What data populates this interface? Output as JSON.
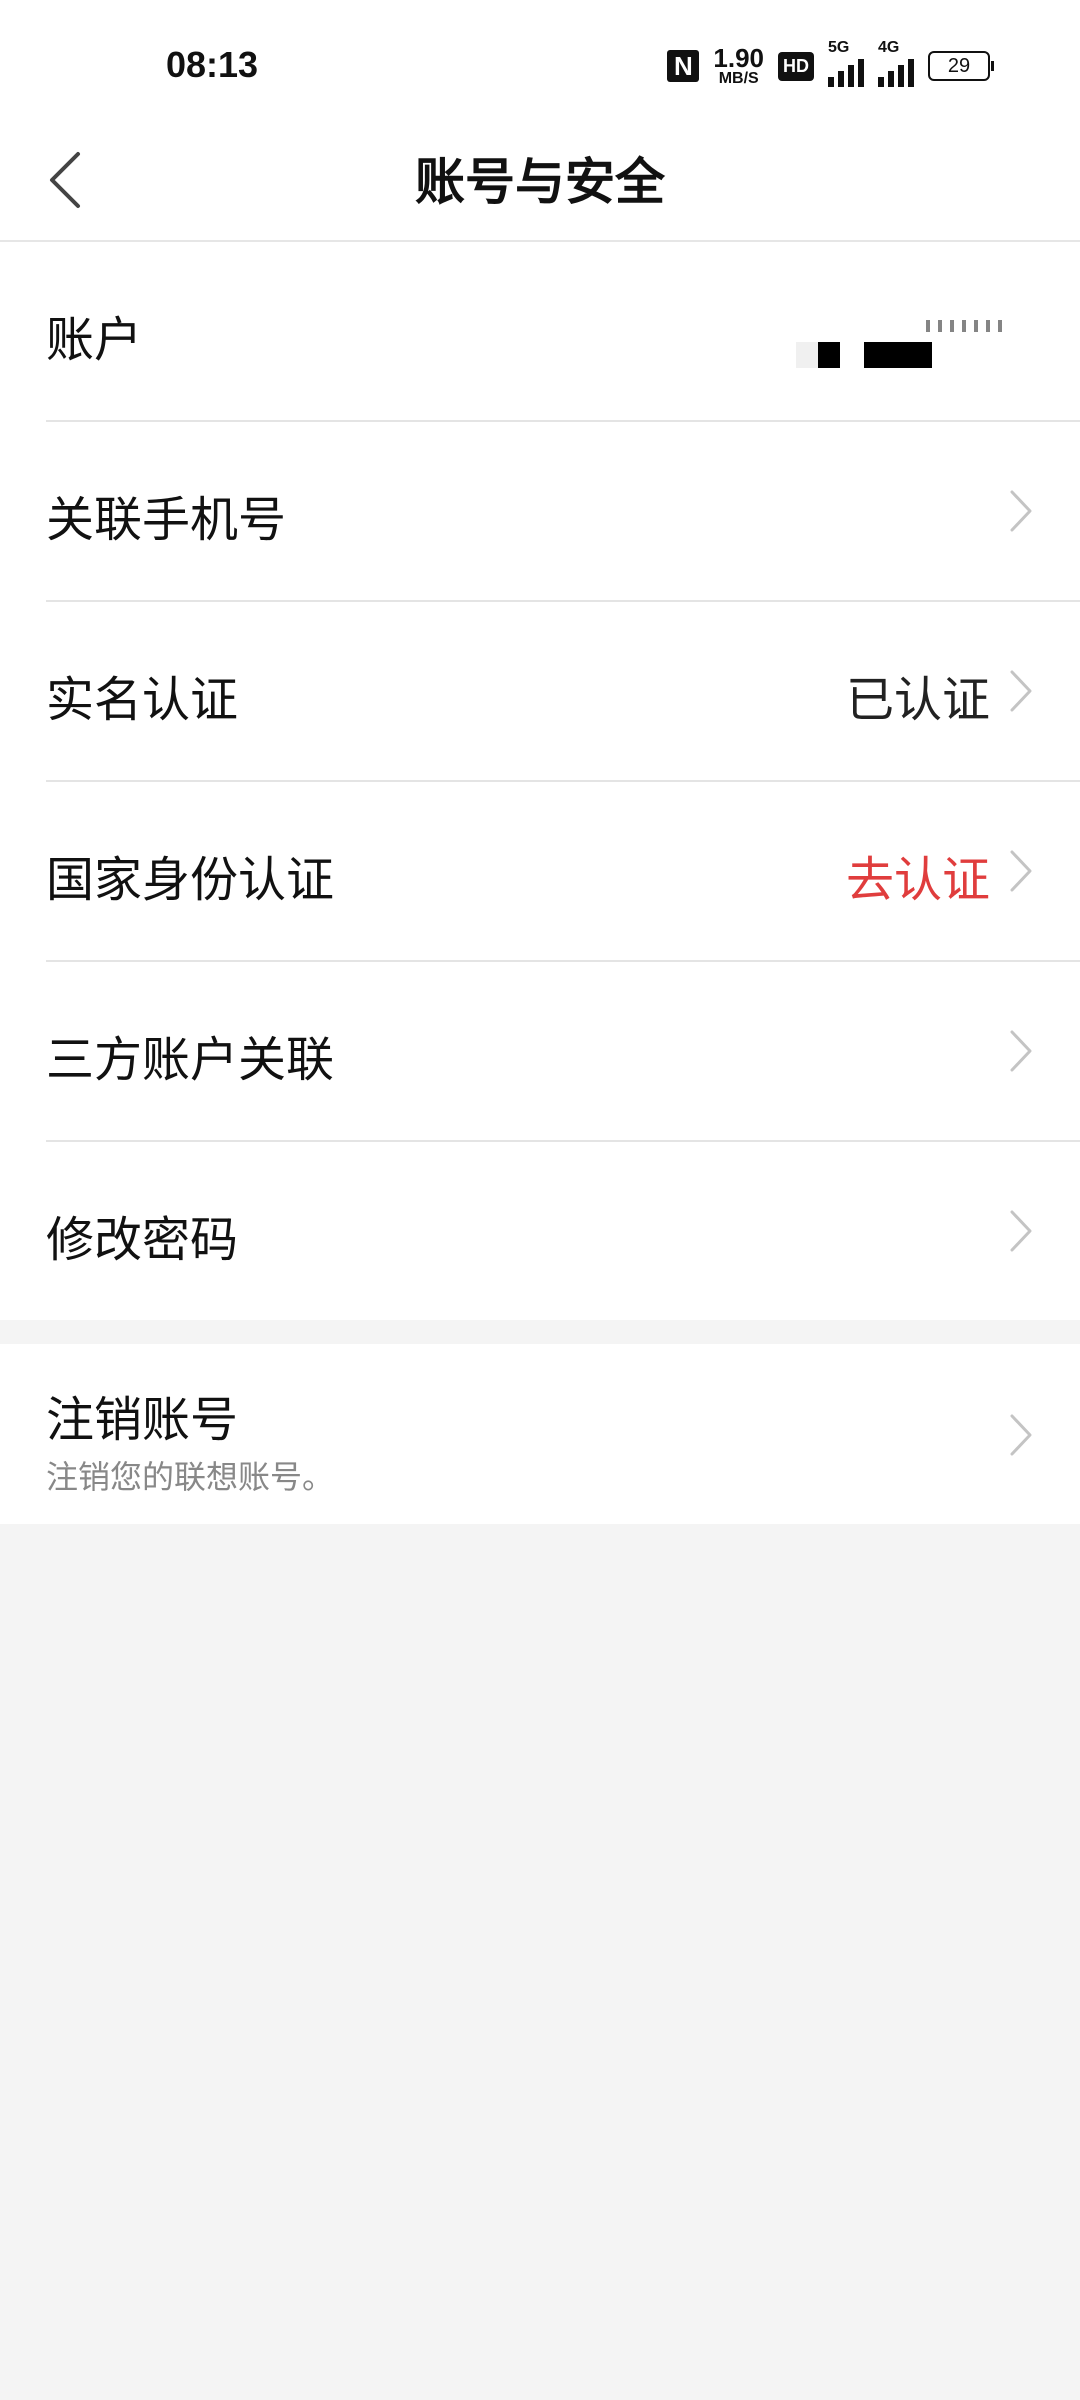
{
  "status_bar": {
    "time": "08:13",
    "net_speed_value": "1.90",
    "net_speed_unit": "MB/S",
    "hd_label": "HD",
    "signal1_label": "5G",
    "signal2_label": "4G",
    "battery_level": "29"
  },
  "header": {
    "title": "账号与安全"
  },
  "settings": {
    "account": {
      "label": "账户"
    },
    "phone": {
      "label": "关联手机号"
    },
    "realname": {
      "label": "实名认证",
      "value": "已认证"
    },
    "national_id": {
      "label": "国家身份认证",
      "value": "去认证",
      "value_color": "#e03d3d"
    },
    "third_party": {
      "label": "三方账户关联"
    },
    "password": {
      "label": "修改密码"
    }
  },
  "deactivate": {
    "label": "注销账号",
    "subtitle": "注销您的联想账号。"
  },
  "icons": {
    "back": "back-arrow-icon",
    "chevron": "chevron-right-icon"
  }
}
